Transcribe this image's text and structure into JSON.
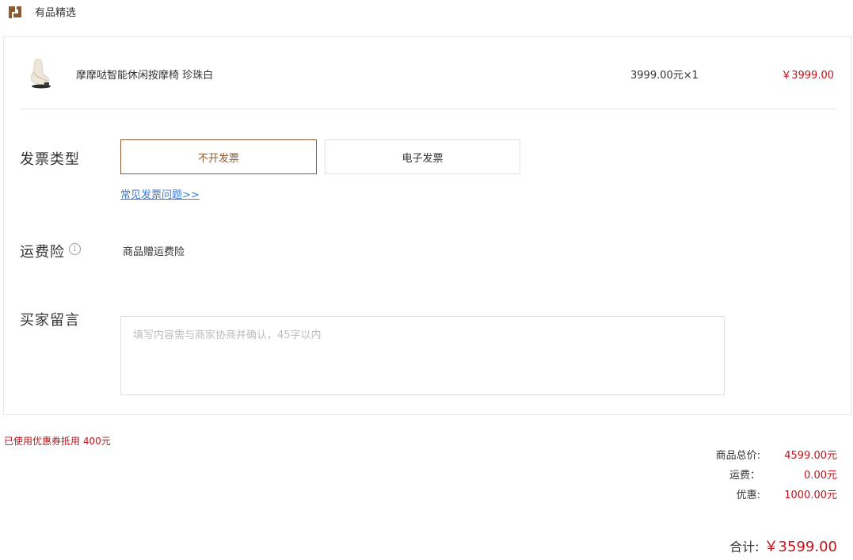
{
  "shop": {
    "logo_icon": "shop-logo-icon",
    "name": "有品精选"
  },
  "product": {
    "thumb_icon": "massage-chair-image",
    "name": "摩摩哒智能休闲按摩椅 珍珠白",
    "unit_qty": "3999.00元×1",
    "line_total": "￥3999.00"
  },
  "invoice": {
    "label": "发票类型",
    "options": [
      {
        "label": "不开发票",
        "selected": true
      },
      {
        "label": "电子发票",
        "selected": false
      }
    ],
    "faq_link": "常见发票问题>>"
  },
  "insurance": {
    "label": "运费险",
    "info_icon": "info-icon",
    "value": "商品赠运费险"
  },
  "message": {
    "label": "买家留言",
    "value": "",
    "placeholder": "填写内容需与商家协商并确认，45字以内"
  },
  "coupon_note": "已使用优惠券抵用 400元",
  "summary": {
    "subtotal_label": "商品总价:",
    "subtotal_value": "4599.00元",
    "shipping_label": "运费：",
    "shipping_value": "0.00元",
    "discount_label": "优惠:",
    "discount_value": "1000.00元",
    "total_label": "合计:",
    "total_value": "￥3599.00"
  },
  "colors": {
    "accent_brown": "#8a5a32",
    "price_red": "#c0131a",
    "link_blue": "#3b7bd4"
  }
}
